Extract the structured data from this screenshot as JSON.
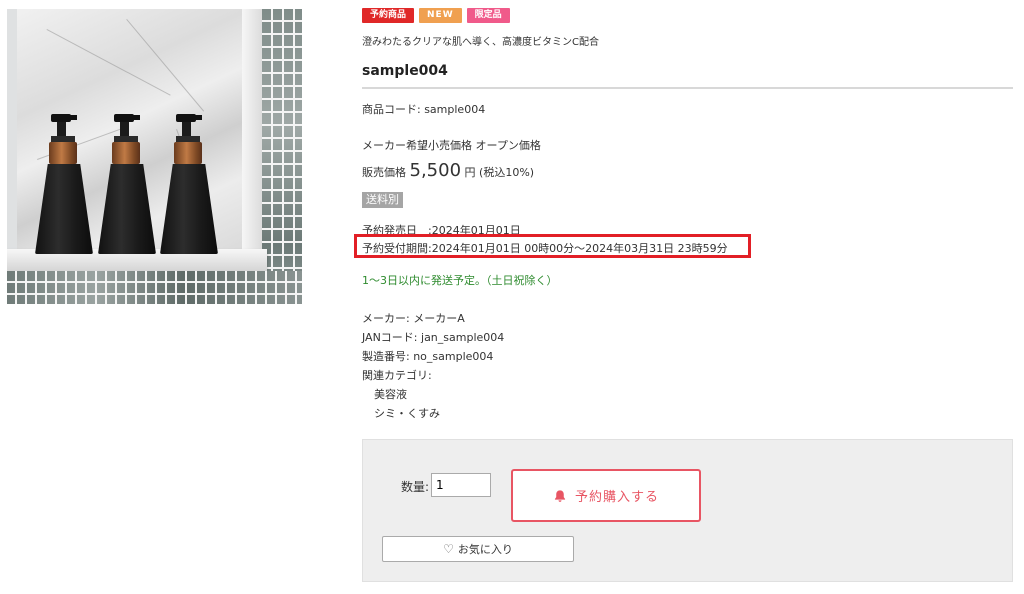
{
  "product_image": {
    "description_icon": "product-photo"
  },
  "badges": [
    "予約商品",
    "NEW",
    "限定品"
  ],
  "catch_copy": "澄みわたるクリアな肌へ導く、高濃度ビタミンC配合",
  "product_name": "sample004",
  "product_code": "商品コード: sample004",
  "list_price": "メーカー希望小売価格 オープン価格",
  "price": {
    "label": "販売価格",
    "amount": "5,500",
    "unit": "円",
    "tax": "(税込10%)"
  },
  "shipping_badge": "送料別",
  "release_date": "予約発売日　:2024年01月01日",
  "reservation_period": "予約受付期間:2024年01月01日 00時00分～2024年03月31日 23時59分",
  "ship_note": "1～3日以内に発送予定。（土日祝除く）",
  "specs": {
    "maker": "メーカー: メーカーA",
    "jan": "JANコード: jan_sample004",
    "serial": "製造番号: no_sample004",
    "categories_label": "関連カテゴリ:",
    "categories": [
      "美容液",
      "シミ・くすみ"
    ]
  },
  "cart": {
    "qty_label": "数量:",
    "qty_value": "1",
    "buy_label": "予約購入する",
    "favorite_label": "お気に入り"
  },
  "colors": {
    "highlight": "#e21f26",
    "buy_accent": "#e85563",
    "ship_note": "#2e8b2e"
  }
}
